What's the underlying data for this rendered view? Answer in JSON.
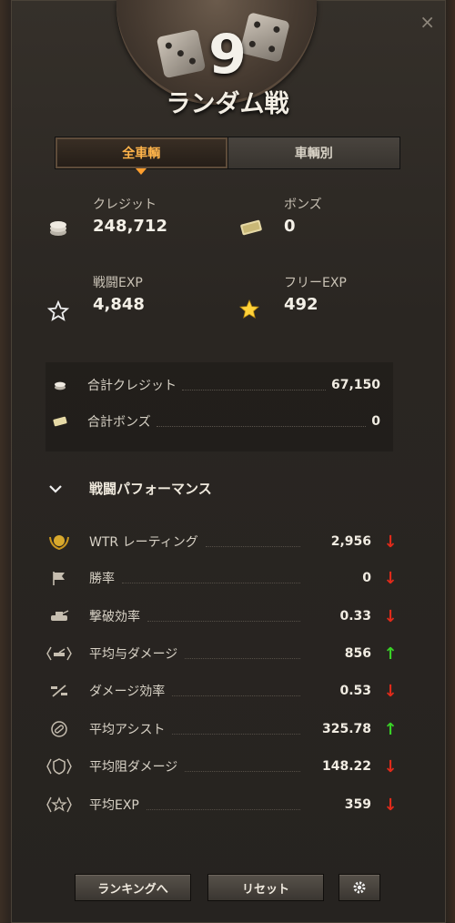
{
  "header": {
    "level": "9",
    "mode_title": "ランダム戦",
    "close_glyph": "×"
  },
  "tabs": [
    {
      "label": "全車輌",
      "active": true
    },
    {
      "label": "車輌別",
      "active": false
    }
  ],
  "stats": {
    "credits": {
      "label": "クレジット",
      "value": "248,712",
      "icon": "credits-icon"
    },
    "bonds": {
      "label": "ボンズ",
      "value": "0",
      "icon": "bonds-icon"
    },
    "battle_exp": {
      "label": "戦闘EXP",
      "value": "4,848",
      "icon": "star-outline-icon"
    },
    "free_exp": {
      "label": "フリーEXP",
      "value": "492",
      "icon": "star-gold-icon"
    }
  },
  "totals": [
    {
      "label": "合計クレジット",
      "value": "67,150",
      "icon": "credits-icon"
    },
    {
      "label": "合計ボンズ",
      "value": "0",
      "icon": "bonds-icon"
    }
  ],
  "performance": {
    "title": "戦闘パフォーマンス",
    "rows": [
      {
        "label": "WTR レーティング",
        "value": "2,956",
        "trend": "down",
        "icon": "wtr-laurel-icon"
      },
      {
        "label": "勝率",
        "value": "0",
        "trend": "down",
        "icon": "flag-icon"
      },
      {
        "label": "撃破効率",
        "value": "0.33",
        "trend": "down",
        "icon": "destroyed-tank-icon"
      },
      {
        "label": "平均与ダメージ",
        "value": "856",
        "trend": "up",
        "icon": "damage-dealt-icon"
      },
      {
        "label": "ダメージ効率",
        "value": "0.53",
        "trend": "down",
        "icon": "damage-ratio-icon"
      },
      {
        "label": "平均アシスト",
        "value": "325.78",
        "trend": "up",
        "icon": "assist-icon"
      },
      {
        "label": "平均阻ダメージ",
        "value": "148.22",
        "trend": "down",
        "icon": "blocked-damage-icon"
      },
      {
        "label": "平均EXP",
        "value": "359",
        "trend": "down",
        "icon": "avg-exp-icon"
      }
    ]
  },
  "footer": {
    "ranking_label": "ランキングへ",
    "reset_label": "リセット",
    "settings_icon": "gear-icon"
  },
  "colors": {
    "accent_orange": "#ff9f2e",
    "trend_up": "#39d226",
    "trend_down": "#e02a1a"
  }
}
